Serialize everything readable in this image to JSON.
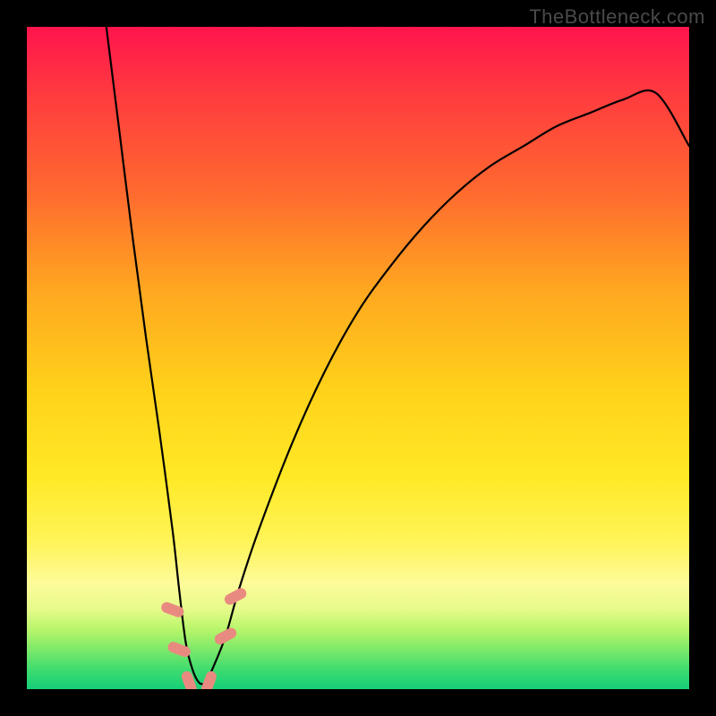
{
  "attribution": "TheBottleneck.com",
  "chart_data": {
    "type": "line",
    "title": "",
    "xlabel": "",
    "ylabel": "",
    "xlim": [
      0,
      100
    ],
    "ylim": [
      0,
      100
    ],
    "series": [
      {
        "name": "bottleneck-curve",
        "x": [
          12,
          14,
          16,
          18,
          20,
          22,
          23,
          24,
          25,
          26,
          27,
          28,
          30,
          32,
          35,
          40,
          45,
          50,
          55,
          60,
          65,
          70,
          75,
          80,
          85,
          90,
          95,
          100
        ],
        "values": [
          100,
          84,
          68,
          53,
          39,
          24,
          15,
          7,
          3,
          1,
          1,
          3,
          8,
          15,
          24,
          37,
          48,
          57,
          64,
          70,
          75,
          79,
          82,
          85,
          87,
          89,
          90,
          82
        ]
      }
    ],
    "markers": [
      {
        "x": 22.0,
        "y": 12,
        "rotation": -70
      },
      {
        "x": 23.0,
        "y": 6,
        "rotation": -70
      },
      {
        "x": 24.5,
        "y": 1,
        "rotation": -20
      },
      {
        "x": 27.5,
        "y": 1,
        "rotation": 20
      },
      {
        "x": 30.0,
        "y": 8,
        "rotation": 62
      },
      {
        "x": 31.5,
        "y": 14,
        "rotation": 62
      }
    ]
  }
}
